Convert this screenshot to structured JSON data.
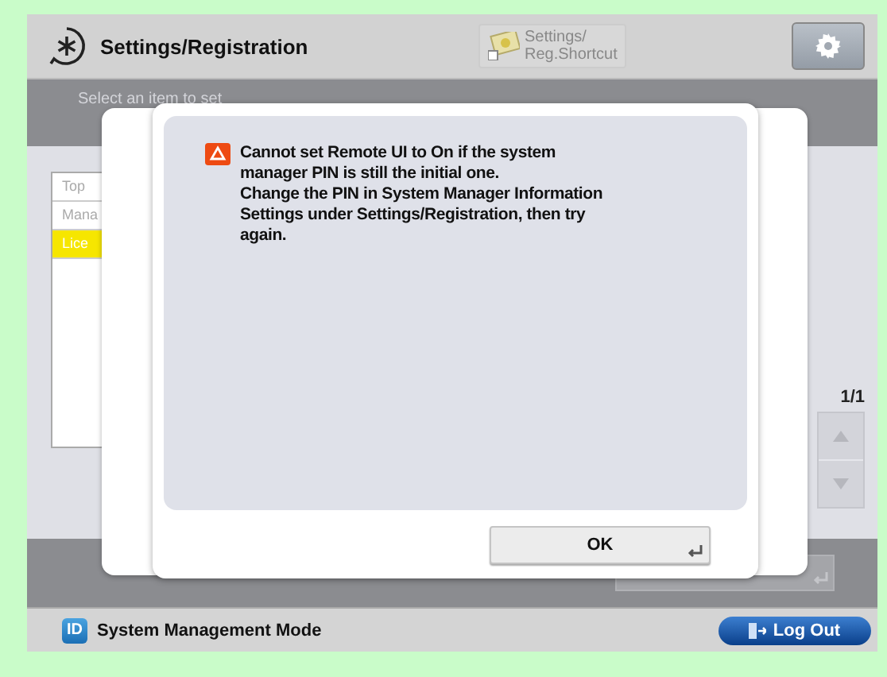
{
  "header": {
    "title": "Settings/Registration",
    "shortcut_lines": [
      "Settings/",
      "Reg.Shortcut"
    ]
  },
  "instruction": "Select an item to set",
  "list": {
    "items": [
      {
        "label": "Top",
        "selected": false
      },
      {
        "label": "Mana",
        "selected": false
      },
      {
        "label": "Lice",
        "selected": true
      }
    ]
  },
  "pager": {
    "page": "1/1"
  },
  "dialog": {
    "message_lines": [
      "Cannot set Remote UI to On if the system",
      "manager PIN is still the initial one.",
      "Change the PIN in System Manager Information",
      "Settings under Settings/Registration, then try",
      "again."
    ],
    "ok": "OK"
  },
  "status_bar": {
    "badge": "ID",
    "mode": "System Management Mode",
    "logout": "Log Out"
  }
}
